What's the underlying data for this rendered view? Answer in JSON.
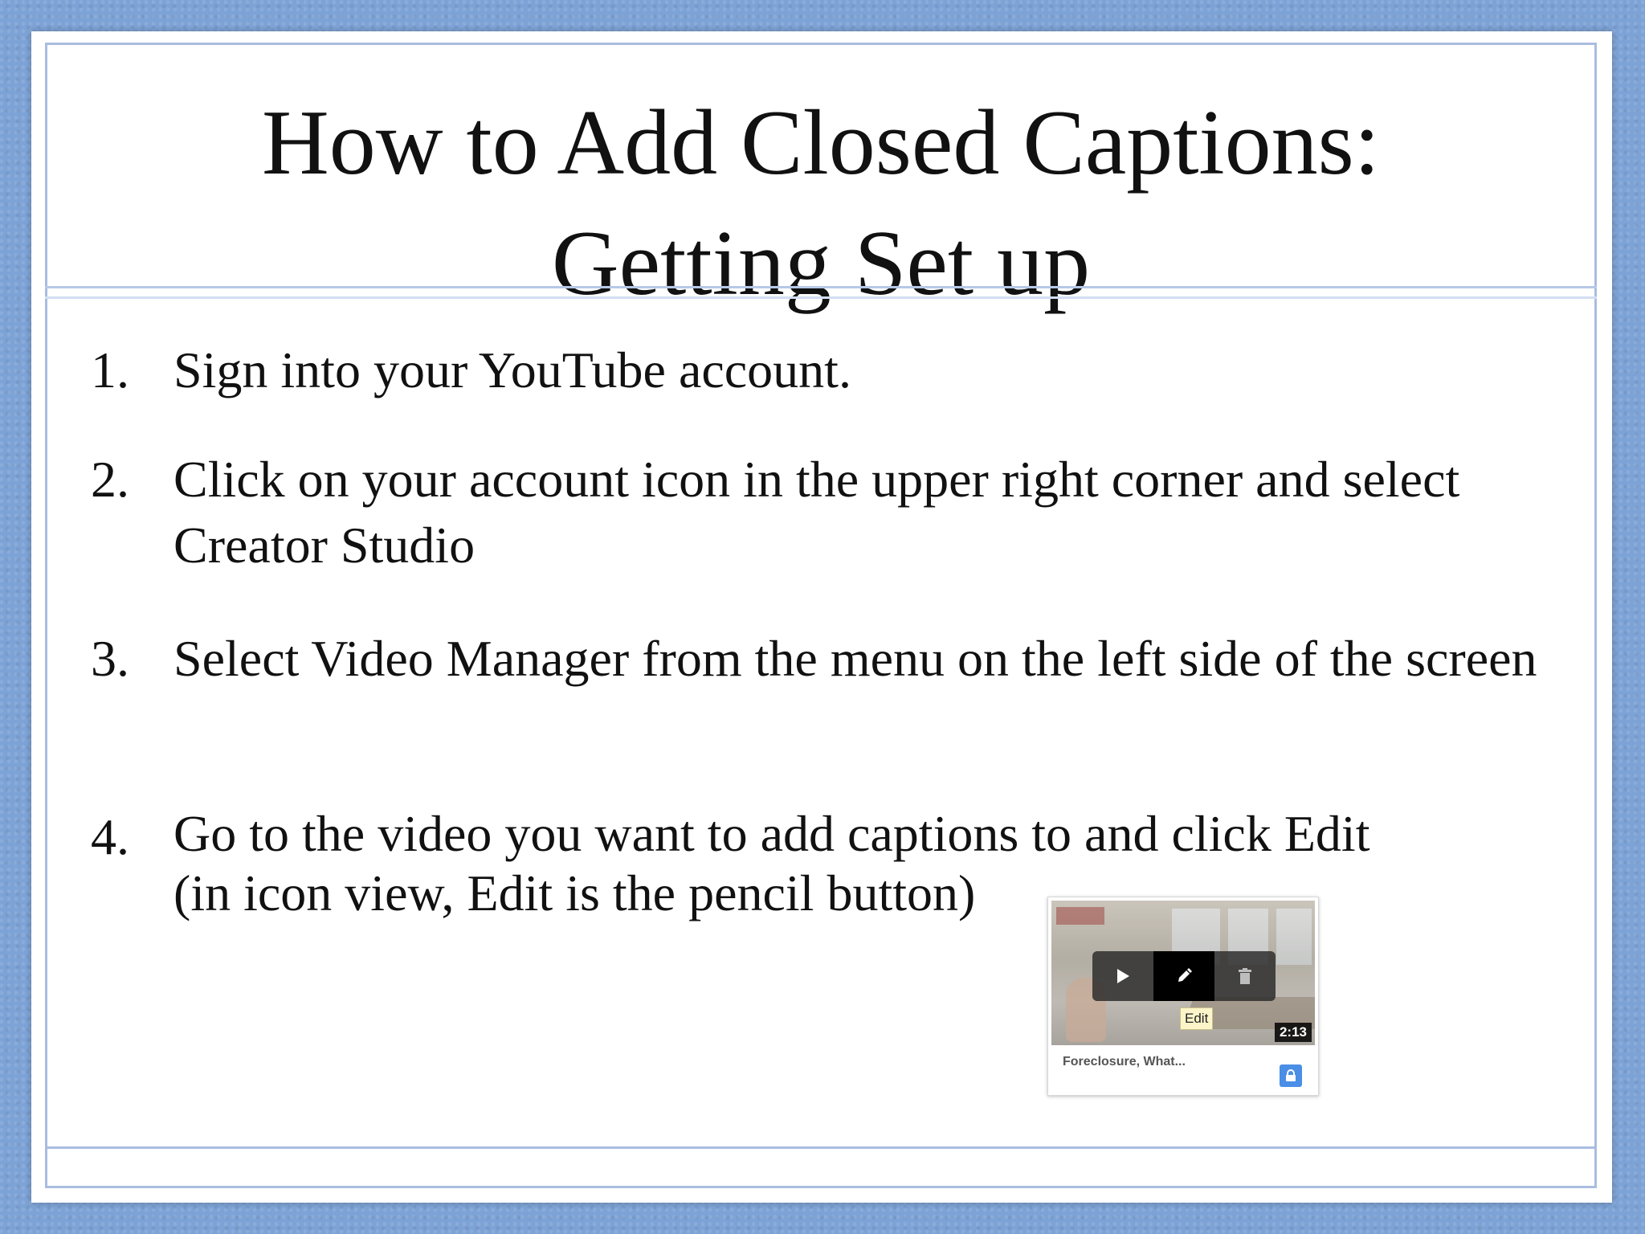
{
  "slide": {
    "title_line1": "How to Add Closed Captions:",
    "title_line2": "Getting Set up",
    "steps": [
      {
        "number": "1.",
        "text": "Sign into your YouTube account."
      },
      {
        "number": "2.",
        "text": "Click on your account icon in the upper right corner and select Creator Studio"
      },
      {
        "number": "3.",
        "text": "Select Video Manager from the menu on the left side of the screen"
      },
      {
        "number": "4.",
        "text_line1": "Go to the video you want to add captions to and click Edit",
        "text_line2": "(in icon view, Edit is the pencil button)"
      }
    ]
  },
  "video_card": {
    "tooltip": "Edit",
    "duration": "2:13",
    "video_title": "Foreclosure, What...",
    "icons": {
      "play": "play-icon",
      "edit": "pencil-icon",
      "delete": "trash-icon",
      "privacy": "lock-icon"
    },
    "privacy_color": "#4a8ee6"
  },
  "theme": {
    "background": "#7da3d6",
    "frame": "#a9bde0"
  }
}
